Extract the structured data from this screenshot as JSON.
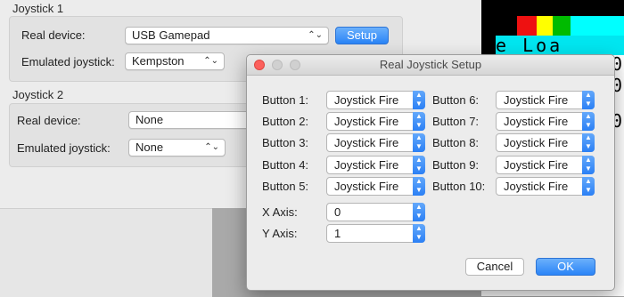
{
  "prefs": {
    "joystick1": {
      "title": "Joystick 1",
      "real_device_label": "Real device:",
      "real_device_value": "USB Gamepad",
      "setup_label": "Setup",
      "emulated_label": "Emulated joystick:",
      "emulated_value": "Kempston"
    },
    "joystick2": {
      "title": "Joystick 2",
      "real_device_label": "Real device:",
      "real_device_value": "None",
      "emulated_label": "Emulated joystick:",
      "emulated_value": "None"
    }
  },
  "screen": {
    "text": "e Loa",
    "side_chars": [
      "0",
      "0",
      "0"
    ]
  },
  "dialog": {
    "title": "Real Joystick Setup",
    "buttons_left": [
      {
        "label": "Button 1:",
        "value": "Joystick Fire"
      },
      {
        "label": "Button 2:",
        "value": "Joystick Fire"
      },
      {
        "label": "Button 3:",
        "value": "Joystick Fire"
      },
      {
        "label": "Button 4:",
        "value": "Joystick Fire"
      },
      {
        "label": "Button 5:",
        "value": "Joystick Fire"
      }
    ],
    "buttons_right": [
      {
        "label": "Button 6:",
        "value": "Joystick Fire"
      },
      {
        "label": "Button 7:",
        "value": "Joystick Fire"
      },
      {
        "label": "Button 8:",
        "value": "Joystick Fire"
      },
      {
        "label": "Button 9:",
        "value": "Joystick Fire"
      },
      {
        "label": "Button 10:",
        "value": "Joystick Fire"
      }
    ],
    "x_axis": {
      "label": "X Axis:",
      "value": "0"
    },
    "y_axis": {
      "label": "Y Axis:",
      "value": "1"
    },
    "cancel_label": "Cancel",
    "ok_label": "OK"
  },
  "colors": {
    "accent": "#2a84f7",
    "close": "#fc605c"
  }
}
